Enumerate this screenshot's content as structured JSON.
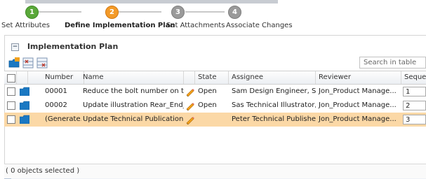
{
  "wizard": {
    "steps": [
      {
        "number": "1",
        "label": "Set Attributes",
        "state": "done"
      },
      {
        "number": "2",
        "label": "Define Implementation Plan",
        "state": "active"
      },
      {
        "number": "3",
        "label": "Set Attachments",
        "state": "pending"
      },
      {
        "number": "4",
        "label": "Associate Changes",
        "state": "pending"
      }
    ]
  },
  "panel": {
    "title": "Implementation Plan",
    "collapse_icon": "−",
    "toolbar": [
      "folder-add-icon",
      "insert-row-icon",
      "remove-row-icon"
    ],
    "search_placeholder": "Search in table"
  },
  "table": {
    "columns": [
      "Number",
      "Name",
      "State",
      "Assignee",
      "Reviewer",
      "Sequence"
    ],
    "rows": [
      {
        "number": "00001",
        "name": "Reduce the bolt number on th...",
        "state": "Open",
        "assignee": "Sam Design Engineer, Sa...",
        "reviewer": "Jon_Product Manage...",
        "sequence": "1",
        "selected": false
      },
      {
        "number": "00002",
        "name": "Update illustration Rear_End_...",
        "state": "Open",
        "assignee": "Sas Technical Illustrator,...",
        "reviewer": "Jon_Product Manage...",
        "sequence": "2",
        "selected": false
      },
      {
        "number": "(Generate...",
        "name": "Update Technical Publication",
        "state": "",
        "assignee": "Peter Technical Publisher...",
        "reviewer": "Jon_Product Manage...",
        "sequence": "3",
        "selected": true
      }
    ]
  },
  "status": "( 0 objects selected )",
  "colors": {
    "done": "#5aa83a",
    "active": "#f39a28",
    "pending": "#9a9a9a",
    "selected_row": "#fbd8a6"
  }
}
